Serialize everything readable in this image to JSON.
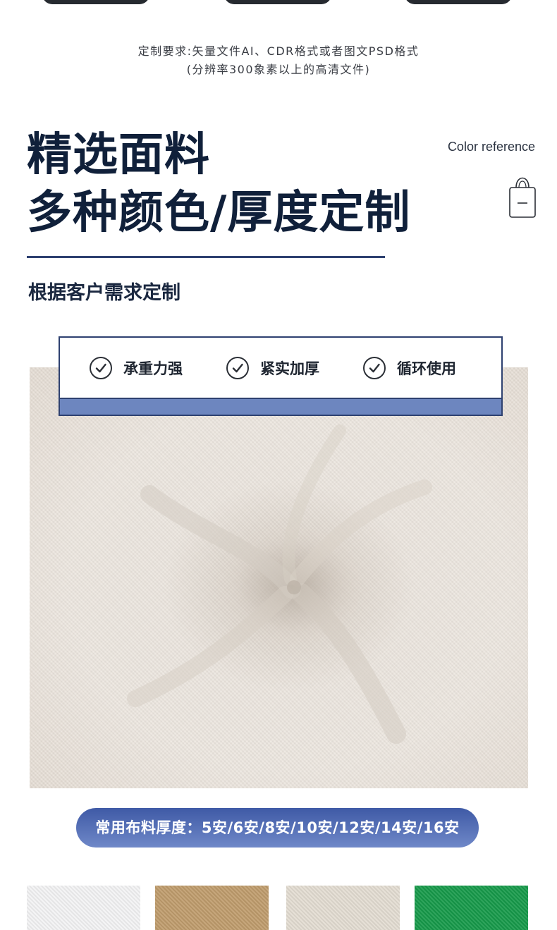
{
  "requirements": {
    "line1": "定制要求:矢量文件AI、CDR格式或者图文PSD格式",
    "line2": "(分辨率300象素以上的高清文件)"
  },
  "headline": {
    "line1": "精选面料",
    "line2": "多种颜色/厚度定制"
  },
  "color_reference": {
    "label": "Color reference",
    "icon": "tote-bag-icon"
  },
  "subheading": "根据客户需求定制",
  "features": [
    {
      "label": "承重力强",
      "icon": "check-circle-icon"
    },
    {
      "label": "紧实加厚",
      "icon": "check-circle-icon"
    },
    {
      "label": "循环使用",
      "icon": "check-circle-icon"
    }
  ],
  "thickness_banner": "常用布料厚度：5安/6安/8安/10安/12安/14安/16安",
  "swatches": [
    {
      "name": "white-canvas-swatch",
      "color": "#f3f3f4"
    },
    {
      "name": "khaki-canvas-swatch",
      "color": "#bf9c6c"
    },
    {
      "name": "natural-canvas-swatch",
      "color": "#e3ddd2"
    },
    {
      "name": "green-canvas-swatch",
      "color": "#169a4a"
    }
  ],
  "colors": {
    "navy": "#2e4170",
    "accent_blue": "#6d86bf",
    "headline": "#10203a"
  }
}
